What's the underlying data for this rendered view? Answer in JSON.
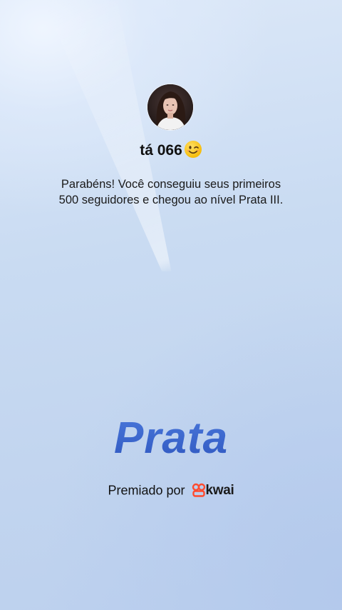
{
  "profile": {
    "username": "tá 066",
    "emoji_icon": "winking-face-emoji"
  },
  "message": {
    "line1": "Parabéns! Você conseguiu seus primeiros",
    "line2": "500 seguidores e chegou ao nível Prata III."
  },
  "level": {
    "title": "Prata",
    "color": "#3a64c8"
  },
  "awarded": {
    "label": "Premiado por",
    "brand": "kwai",
    "brand_icon": "kwai-logo-icon",
    "brand_color": "#ff4a2e"
  },
  "background": {
    "top": "#dce8f8",
    "bottom": "#bcd0ee"
  }
}
